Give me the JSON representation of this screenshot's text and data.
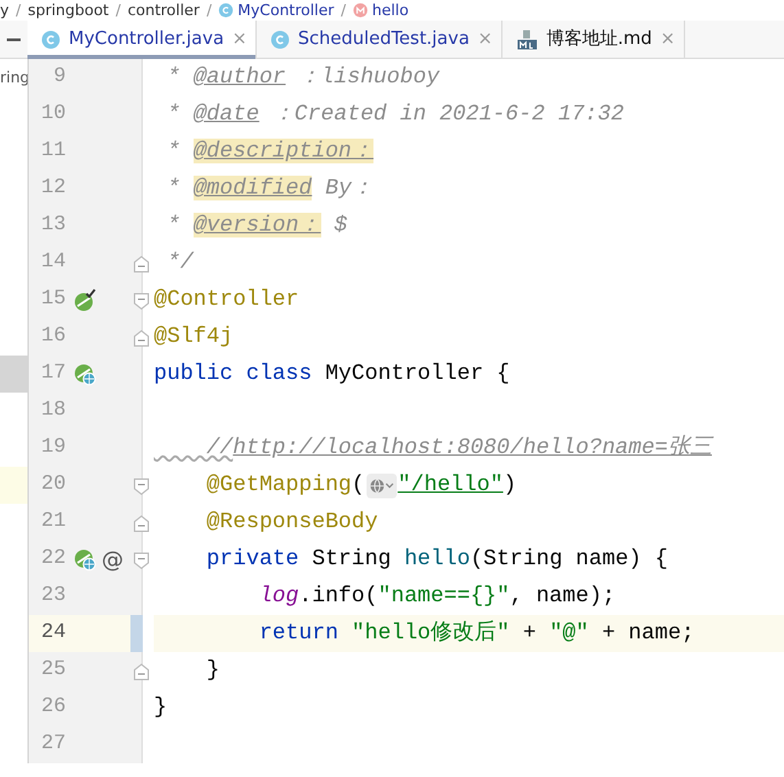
{
  "breadcrumb": {
    "separator": "/",
    "items": [
      {
        "text": "y",
        "kind": "folder"
      },
      {
        "text": "springboot",
        "kind": "folder"
      },
      {
        "text": "controller",
        "kind": "folder"
      },
      {
        "text": "MyController",
        "kind": "class"
      },
      {
        "text": "hello",
        "kind": "method"
      }
    ]
  },
  "project_panel": {
    "text": "ring"
  },
  "tabs": [
    {
      "label": "MyController.java",
      "kind": "class",
      "selected": true,
      "modified": true,
      "close": "×"
    },
    {
      "label": "ScheduledTest.java",
      "kind": "class",
      "selected": false,
      "modified": true,
      "close": "×"
    },
    {
      "label": "博客地址.md",
      "kind": "markdown",
      "selected": false,
      "modified": false,
      "close": "×"
    }
  ],
  "lines": [
    {
      "number": "9",
      "tokens": [
        {
          "kind": "comment",
          "text": " * "
        },
        {
          "kind": "tag",
          "text": "@author"
        },
        {
          "kind": "comment",
          "text": " ：lishuoboy"
        }
      ]
    },
    {
      "number": "10",
      "tokens": [
        {
          "kind": "comment",
          "text": " * "
        },
        {
          "kind": "tag",
          "text": "@date"
        },
        {
          "kind": "comment",
          "text": " ：Created in 2021-6-2 17:32"
        }
      ]
    },
    {
      "number": "11",
      "tokens": [
        {
          "kind": "comment",
          "text": " * "
        },
        {
          "kind": "tag-hl",
          "text": "@description："
        }
      ]
    },
    {
      "number": "12",
      "tokens": [
        {
          "kind": "comment",
          "text": " * "
        },
        {
          "kind": "tag-hl",
          "text": "@modified"
        },
        {
          "kind": "comment",
          "text": " By："
        }
      ]
    },
    {
      "number": "13",
      "tokens": [
        {
          "kind": "comment",
          "text": " * "
        },
        {
          "kind": "tag-hl",
          "text": "@version："
        },
        {
          "kind": "comment",
          "text": " $"
        }
      ]
    },
    {
      "number": "14",
      "fold_end": true,
      "tokens": [
        {
          "kind": "comment",
          "text": " */"
        }
      ]
    },
    {
      "number": "15",
      "fold_start": true,
      "gutter": [
        {
          "kind": "bean-check"
        }
      ],
      "tokens": [
        {
          "kind": "annotation",
          "text": "@Controller"
        }
      ]
    },
    {
      "number": "16",
      "fold_end": true,
      "tokens": [
        {
          "kind": "annotation",
          "text": "@Slf4j"
        }
      ]
    },
    {
      "number": "17",
      "tree_selected": true,
      "gutter": [
        {
          "kind": "bean-web"
        }
      ],
      "tokens": [
        {
          "kind": "keyword",
          "text": "public class "
        },
        {
          "kind": "plain",
          "text": "MyController {"
        }
      ]
    },
    {
      "number": "18"
    },
    {
      "number": "19",
      "tokens": [
        {
          "kind": "comment-typo",
          "text": "    //"
        },
        {
          "kind": "comment-link",
          "text": "http://localhost:8080/hello?name=张三"
        }
      ]
    },
    {
      "number": "20",
      "fold_start": true,
      "tree_hover": true,
      "tokens": [
        {
          "kind": "annotation",
          "text": "    @GetMapping"
        },
        {
          "kind": "plain",
          "text": "("
        },
        {
          "kind": "inlay"
        },
        {
          "kind": "string-link",
          "text": "\"/hello\""
        },
        {
          "kind": "plain",
          "text": ")"
        }
      ]
    },
    {
      "number": "21",
      "fold_end": true,
      "tokens": [
        {
          "kind": "annotation",
          "text": "    @ResponseBody"
        }
      ]
    },
    {
      "number": "22",
      "fold_start": true,
      "gutter": [
        {
          "kind": "bean-web"
        },
        {
          "kind": "text",
          "text": "@"
        }
      ],
      "tokens": [
        {
          "kind": "keyword",
          "text": "    private "
        },
        {
          "kind": "plain",
          "text": "String "
        },
        {
          "kind": "method",
          "text": "hello"
        },
        {
          "kind": "plain",
          "text": "(String name) {"
        }
      ]
    },
    {
      "number": "23",
      "tokens": [
        {
          "kind": "field",
          "text": "        log"
        },
        {
          "kind": "plain",
          "text": ".info("
        },
        {
          "kind": "string",
          "text": "\"name=={}\""
        },
        {
          "kind": "plain",
          "text": ", name);"
        }
      ]
    },
    {
      "number": "24",
      "current": true,
      "changed": true,
      "tokens": [
        {
          "kind": "keyword",
          "text": "        return "
        },
        {
          "kind": "string",
          "text": "\"hello修改后\""
        },
        {
          "kind": "plain",
          "text": " + "
        },
        {
          "kind": "string",
          "text": "\"@\""
        },
        {
          "kind": "plain",
          "text": " + name;"
        }
      ]
    },
    {
      "number": "25",
      "fold_end": true,
      "tokens": [
        {
          "kind": "plain",
          "text": "    }"
        }
      ]
    },
    {
      "number": "26",
      "tokens": [
        {
          "kind": "plain",
          "text": "}"
        }
      ]
    },
    {
      "number": "27"
    }
  ]
}
